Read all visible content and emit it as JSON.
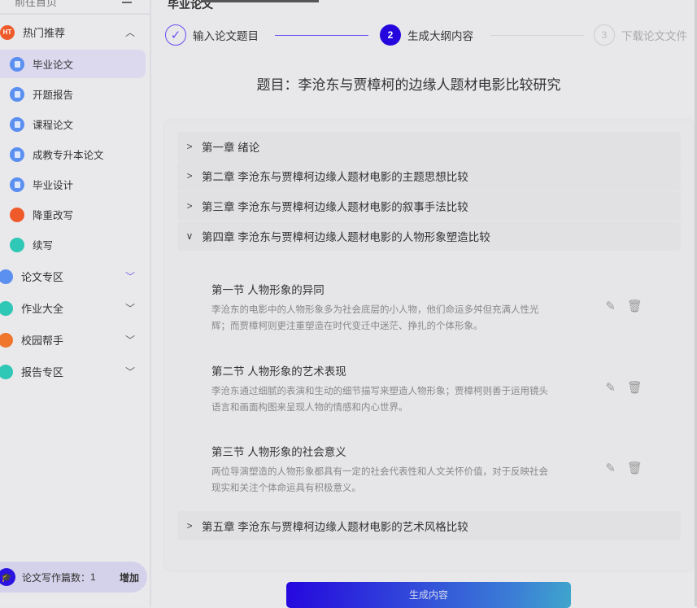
{
  "sidebar": {
    "top_link": "前往首页",
    "hot": {
      "label": "热门推荐",
      "badge": "HT",
      "items": [
        {
          "label": "毕业论文"
        },
        {
          "label": "开题报告"
        },
        {
          "label": "课程论文"
        },
        {
          "label": "成教专升本论文"
        },
        {
          "label": "毕业设计"
        },
        {
          "label": "降重改写"
        },
        {
          "label": "续写"
        }
      ]
    },
    "groups": [
      {
        "label": "论文专区",
        "color": "#5b8ff0"
      },
      {
        "label": "作业大全",
        "color": "#2fc7b5"
      },
      {
        "label": "校园帮手",
        "color": "#f0762e"
      },
      {
        "label": "报告专区",
        "color": "#2fc7b5"
      }
    ],
    "footer": {
      "label": "论文写作篇数：",
      "count": "1",
      "add": "增加"
    }
  },
  "main": {
    "title": "毕业论文",
    "steps": [
      {
        "label": "输入论文题目",
        "state": "done"
      },
      {
        "num": "2",
        "label": "生成大纲内容",
        "state": "active"
      },
      {
        "num": "3",
        "label": "下载论文文件",
        "state": "pending"
      }
    ],
    "topic": "题目：李沧东与贾樟柯的边缘人题材电影比较研究",
    "chapters": [
      {
        "title": "第一章 绪论"
      },
      {
        "title": "第二章 李沧东与贾樟柯边缘人题材电影的主题思想比较"
      },
      {
        "title": "第三章 李沧东与贾樟柯边缘人题材电影的叙事手法比较"
      },
      {
        "title": "第四章 李沧东与贾樟柯边缘人题材电影的人物形象塑造比较",
        "expanded": true,
        "sections": [
          {
            "title": "第一节 人物形象的异同",
            "desc": "李沧东的电影中的人物形象多为社会底层的小人物，他们命运多舛但充满人性光辉；而贾樟柯则更注重塑造在时代变迁中迷茫、挣扎的个体形象。"
          },
          {
            "title": "第二节 人物形象的艺术表现",
            "desc": "李沧东通过细腻的表演和生动的细节描写来塑造人物形象；贾樟柯则善于运用镜头语言和画面构图来呈现人物的情感和内心世界。"
          },
          {
            "title": "第三节 人物形象的社会意义",
            "desc": "两位导演塑造的人物形象都具有一定的社会代表性和人文关怀价值，对于反映社会现实和关注个体命运具有积极意义。"
          }
        ]
      },
      {
        "title": "第五章 李沧东与贾樟柯边缘人题材电影的艺术风格比较"
      }
    ],
    "generate_button": "生成内容"
  }
}
